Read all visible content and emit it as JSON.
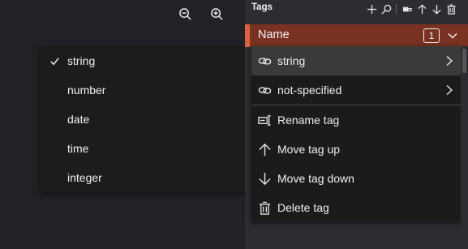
{
  "canvas": {
    "zoom_out_icon": "zoom-out-icon",
    "zoom_in_icon": "zoom-in-icon"
  },
  "type_menu": {
    "items": [
      {
        "label": "string",
        "checked": true
      },
      {
        "label": "number",
        "checked": false
      },
      {
        "label": "date",
        "checked": false
      },
      {
        "label": "time",
        "checked": false
      },
      {
        "label": "integer",
        "checked": false
      }
    ]
  },
  "tags_panel": {
    "title": "Tags",
    "header_icons": [
      "add-icon",
      "search-icon",
      "lock-icon",
      "move-up-icon",
      "move-down-icon",
      "delete-icon"
    ],
    "tag": {
      "name": "Name",
      "count": "1",
      "color": "#793222",
      "accent_color": "#d9633e"
    }
  },
  "context_menu": {
    "items": [
      {
        "label": "string",
        "icon": "link-icon",
        "submenu": true
      },
      {
        "label": "not-specified",
        "icon": "link-icon",
        "submenu": true
      },
      {
        "label": "Rename tag",
        "icon": "rename-icon",
        "submenu": false
      },
      {
        "label": "Move tag up",
        "icon": "arrow-up-icon",
        "submenu": false
      },
      {
        "label": "Move tag down",
        "icon": "arrow-down-icon",
        "submenu": false
      },
      {
        "label": "Delete tag",
        "icon": "trash-icon",
        "submenu": false
      }
    ]
  }
}
